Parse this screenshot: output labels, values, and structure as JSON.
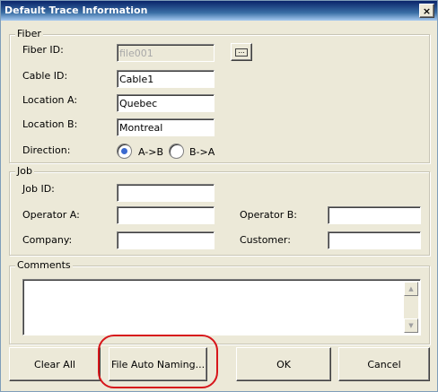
{
  "window": {
    "title": "Default Trace Information",
    "close_glyph": "×"
  },
  "fiber": {
    "legend": "Fiber",
    "fiber_id_label": "Fiber ID:",
    "fiber_id_value": "file001",
    "browse_glyph": "...",
    "cable_id_label": "Cable ID:",
    "cable_id_value": "Cable1",
    "location_a_label": "Location A:",
    "location_a_value": "Quebec",
    "location_b_label": "Location B:",
    "location_b_value": "Montreal",
    "direction_label": "Direction:",
    "direction_options": [
      "A->B",
      "B->A"
    ],
    "direction_selected": "A->B"
  },
  "job": {
    "legend": "Job",
    "job_id_label": "Job ID:",
    "job_id_value": "",
    "operator_a_label": "Operator A:",
    "operator_a_value": "",
    "operator_b_label": "Operator B:",
    "operator_b_value": "",
    "company_label": "Company:",
    "company_value": "",
    "customer_label": "Customer:",
    "customer_value": ""
  },
  "comments": {
    "legend": "Comments",
    "value": ""
  },
  "buttons": {
    "clear_all": "Clear All",
    "file_auto_naming": "File Auto Naming...",
    "ok": "OK",
    "cancel": "Cancel"
  },
  "colors": {
    "highlight": "#d7161b",
    "title_bar": "#0a246a",
    "radio_selected": "#3c6ad0"
  }
}
